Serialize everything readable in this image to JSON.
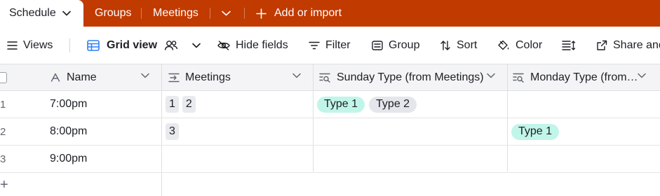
{
  "tabs": {
    "active": "Schedule",
    "items": [
      "Groups",
      "Meetings"
    ],
    "add_label": "Add or import"
  },
  "toolbar": {
    "views": "Views",
    "grid_view": "Grid view",
    "hide_fields": "Hide fields",
    "filter": "Filter",
    "group": "Group",
    "sort": "Sort",
    "color": "Color",
    "share": "Share and"
  },
  "columns": [
    {
      "label": "Name",
      "icon": "text-field-icon"
    },
    {
      "label": "Meetings",
      "icon": "linked-record-icon"
    },
    {
      "label": "Sunday Type (from Meetings)",
      "icon": "lookup-icon"
    },
    {
      "label": "Monday Type (from…",
      "icon": "lookup-icon"
    }
  ],
  "rows": [
    {
      "num": "1",
      "name": "7:00pm",
      "meetings": [
        "1",
        "2"
      ],
      "sunday": [
        "Type 1",
        "Type 2"
      ],
      "monday": []
    },
    {
      "num": "2",
      "name": "8:00pm",
      "meetings": [
        "3"
      ],
      "sunday": [],
      "monday": [
        "Type 1"
      ]
    },
    {
      "num": "3",
      "name": "9:00pm",
      "meetings": [],
      "sunday": [],
      "monday": []
    }
  ],
  "pill_colors": {
    "Type 1": "#c2f5e9",
    "Type 2": "#e5e6eb"
  },
  "add_row_symbol": "+",
  "colors": {
    "accent": "#c13a00",
    "header_bg": "#f4f4f6",
    "grid_icon": "#2d7ff9"
  }
}
